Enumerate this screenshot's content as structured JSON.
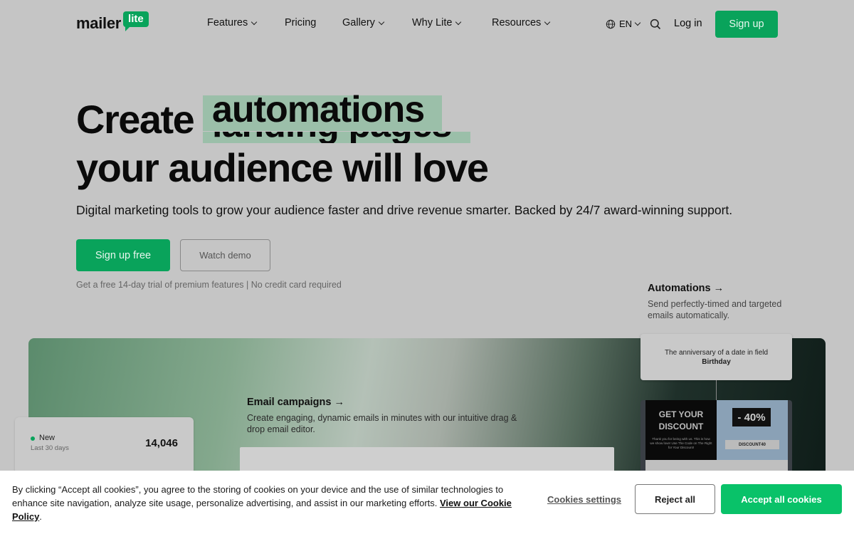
{
  "nav": {
    "logo_word": "mailer",
    "logo_badge": "lite",
    "items": [
      {
        "label": "Features"
      },
      {
        "label": "Pricing"
      },
      {
        "label": "Gallery"
      },
      {
        "label": "Why Lite"
      },
      {
        "label": "Resources"
      }
    ],
    "lang": "EN",
    "login": "Log in",
    "signup": "Sign up"
  },
  "hero": {
    "title_start": "Create",
    "title_highlight": "automations",
    "title_highlight_next": "landing pages",
    "title_end": "your audience will love",
    "subtitle": "Digital marketing tools to grow your audience faster and drive revenue smarter. Backed by 24/7 award-winning support.",
    "cta_primary": "Sign up free",
    "cta_secondary": "Watch demo",
    "trial_note": "Get a free 14-day trial of premium features | No credit card required"
  },
  "features": {
    "automations_title": "Automations →",
    "automations_desc": "Send perfectly-timed and targeted emails automatically.",
    "email_title": "Email campaigns →",
    "email_desc": "Create engaging, dynamic emails in minutes with our intuitive drag & drop email editor."
  },
  "stat_card": {
    "label": "New",
    "period": "Last 30 days",
    "value": "14,046"
  },
  "trigger_card": {
    "text": "The anniversary of a date in field",
    "field": "Birthday"
  },
  "email_preview": {
    "headline": "GET YOUR DISCOUNT",
    "body": "Thank you for being with us. This is how we show love! Use The Code on The Right for Your Discount!",
    "percent": "- 40%",
    "code": "DISCOUNT40"
  },
  "cookie": {
    "text": "By clicking “Accept all cookies”, you agree to the storing of cookies on your device and the use of similar technologies to enhance site navigation, analyze site usage, personalize advertising, and assist in our marketing efforts. ",
    "policy_link": "View our Cookie Policy",
    "period": ".",
    "settings": "Cookies settings",
    "reject": "Reject all",
    "accept": "Accept all cookies"
  },
  "colors": {
    "brand_green": "#09a35b",
    "accept_green": "#09c269",
    "highlight": "#9bbfa9"
  }
}
